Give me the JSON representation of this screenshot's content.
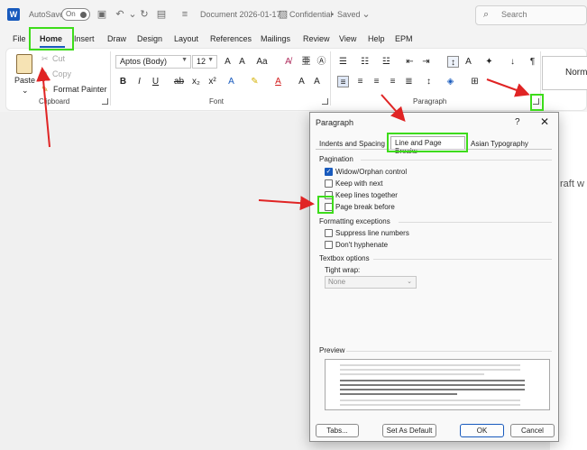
{
  "titlebar": {
    "autosave_label": "AutoSave",
    "autosave_state": "On",
    "doc_title": "Document 2026-01-17",
    "sensitivity": "Confidential",
    "save_state": "Saved",
    "search_placeholder": "Search"
  },
  "menu": {
    "tabs": [
      "File",
      "Home",
      "Insert",
      "Draw",
      "Design",
      "Layout",
      "References",
      "Mailings",
      "Review",
      "View",
      "Help",
      "EPM"
    ],
    "active": "Home"
  },
  "ribbon": {
    "clipboard": {
      "label": "Clipboard",
      "paste": "Paste",
      "cut": "Cut",
      "copy": "Copy",
      "format_painter": "Format Painter"
    },
    "font": {
      "label": "Font",
      "font_name": "Aptos (Body)",
      "font_size": "12"
    },
    "paragraph": {
      "label": "Paragraph"
    },
    "styles": {
      "normal": "Norm"
    }
  },
  "document": {
    "visible_text": "raft w"
  },
  "dialog": {
    "title": "Paragraph",
    "help": "?",
    "close": "✕",
    "tabs": [
      "Indents and Spacing",
      "Line and Page Breaks",
      "Asian Typography"
    ],
    "active_tab": "Line and Page Breaks",
    "pagination": {
      "heading": "Pagination",
      "items": [
        {
          "label": "Widow/Orphan control",
          "checked": true
        },
        {
          "label": "Keep with next",
          "checked": false
        },
        {
          "label": "Keep lines together",
          "checked": false
        },
        {
          "label": "Page break before",
          "checked": false
        }
      ]
    },
    "formatting": {
      "heading": "Formatting exceptions",
      "items": [
        {
          "label": "Suppress line numbers",
          "checked": false
        },
        {
          "label": "Don't hyphenate",
          "checked": false
        }
      ]
    },
    "textbox": {
      "heading": "Textbox options",
      "tight_wrap_label": "Tight wrap:",
      "tight_wrap_value": "None"
    },
    "preview": {
      "heading": "Preview",
      "prev_text": "Previous Paragraph Previous Paragraph Previous Paragraph Previous Paragraph Previous Paragraph",
      "sample_text": "Sample Text Sample Text Sample Text Sample Text Sample Text Sample Text Sample Text",
      "follow_text": "Following Paragraph Following Paragraph Following Paragraph Following Paragraph"
    },
    "buttons": {
      "tabs": "Tabs...",
      "set_default": "Set As Default",
      "ok": "OK",
      "cancel": "Cancel"
    }
  },
  "colors": {
    "accent": "#185abd",
    "highlight": "#3ddc1a",
    "arrow": "#e02424"
  }
}
